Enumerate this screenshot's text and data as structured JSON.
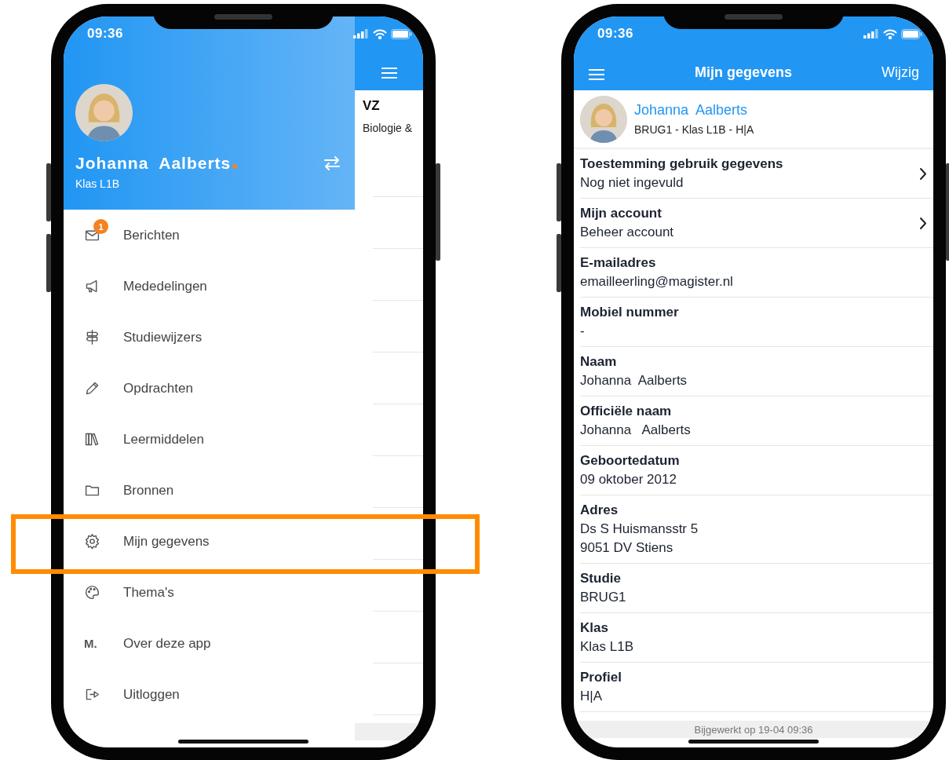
{
  "left_phone": {
    "status_bar": {
      "time": "09:36"
    },
    "drawer": {
      "user": {
        "name": "Johanna  Aalberts",
        "class": "Klas L1B"
      },
      "items": [
        {
          "label": "Berichten",
          "badge": "1",
          "highlighted": false
        },
        {
          "label": "Mededelingen",
          "highlighted": false
        },
        {
          "label": "Studiewijzers",
          "highlighted": false
        },
        {
          "label": "Opdrachten",
          "highlighted": false
        },
        {
          "label": "Leermiddelen",
          "highlighted": false
        },
        {
          "label": "Bronnen",
          "highlighted": false
        },
        {
          "label": "Mijn gegevens",
          "highlighted": true
        },
        {
          "label": "Thema's",
          "highlighted": false
        },
        {
          "label": "Over deze app",
          "icon_text": "M.",
          "highlighted": false
        },
        {
          "label": "Uitloggen",
          "highlighted": false
        }
      ]
    },
    "background_screen": {
      "title": "VZ",
      "subtitle": "Biologie &"
    }
  },
  "right_phone": {
    "status_bar": {
      "time": "09:36"
    },
    "nav_bar": {
      "title": "Mijn gegevens",
      "action": "Wijzig"
    },
    "profile": {
      "name": "Johanna  Aalberts",
      "details": "BRUG1 - Klas L1B - H|A"
    },
    "rows": [
      {
        "label": "Toestemming gebruik gegevens",
        "values": [
          "Nog niet ingevuld"
        ],
        "chevron": true
      },
      {
        "label": "Mijn account",
        "values": [
          "Beheer account"
        ],
        "chevron": true
      },
      {
        "label": "E-mailadres",
        "values": [
          "emailleerling@magister.nl"
        ],
        "chevron": false
      },
      {
        "label": "Mobiel nummer",
        "values": [
          "-"
        ],
        "chevron": false
      },
      {
        "label": "Naam",
        "values": [
          "Johanna  Aalberts"
        ],
        "chevron": false
      },
      {
        "label": "Officiële naam",
        "values": [
          "Johanna   Aalberts"
        ],
        "chevron": false
      },
      {
        "label": "Geboortedatum",
        "values": [
          "09 oktober 2012"
        ],
        "chevron": false
      },
      {
        "label": "Adres",
        "values": [
          "Ds S Huismansstr 5",
          "9051 DV Stiens"
        ],
        "chevron": false
      },
      {
        "label": "Studie",
        "values": [
          "BRUG1"
        ],
        "chevron": false
      },
      {
        "label": "Klas",
        "values": [
          "Klas L1B"
        ],
        "chevron": false
      },
      {
        "label": "Profiel",
        "values": [
          "H|A"
        ],
        "chevron": false
      }
    ],
    "footer": "Bijgewerkt op 19-04 09:36"
  }
}
